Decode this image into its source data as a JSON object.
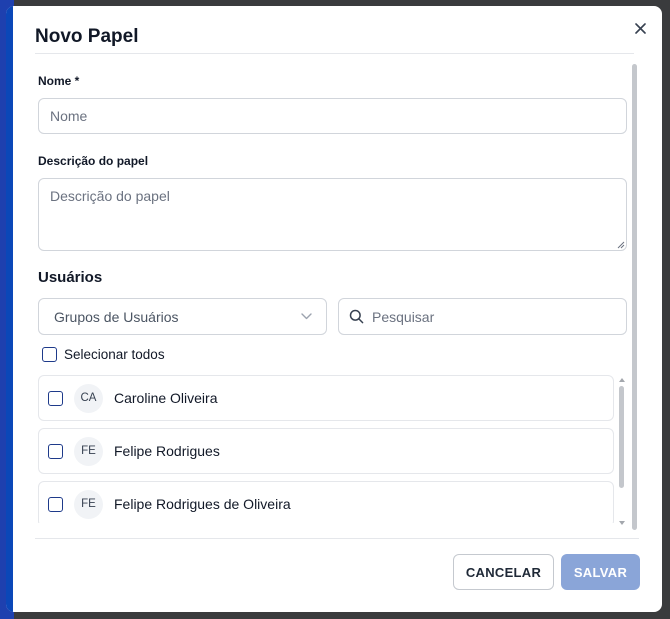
{
  "modal": {
    "title": "Novo Papel",
    "close_icon": "close-icon"
  },
  "form": {
    "name_label": "Nome *",
    "name_placeholder": "Nome",
    "name_value": "",
    "description_label": "Descrição do papel",
    "description_placeholder": "Descrição do papel",
    "description_value": ""
  },
  "users": {
    "section_title": "Usuários",
    "groups_select": {
      "selected": "Grupos de Usuários",
      "icon": "chevron-down-icon"
    },
    "search": {
      "placeholder": "Pesquisar",
      "icon": "search-icon"
    },
    "select_all_label": "Selecionar todos",
    "list": [
      {
        "initials": "CA",
        "name": "Caroline Oliveira",
        "checked": false
      },
      {
        "initials": "FE",
        "name": "Felipe Rodrigues",
        "checked": false
      },
      {
        "initials": "FE",
        "name": "Felipe Rodrigues de Oliveira",
        "checked": false
      }
    ]
  },
  "footer": {
    "cancel_label": "CANCELAR",
    "save_label": "SALVAR"
  },
  "colors": {
    "accent": "#0b47b8",
    "save_button_disabled": "#8aa5d8",
    "checkbox_border": "#1e3a8a"
  }
}
